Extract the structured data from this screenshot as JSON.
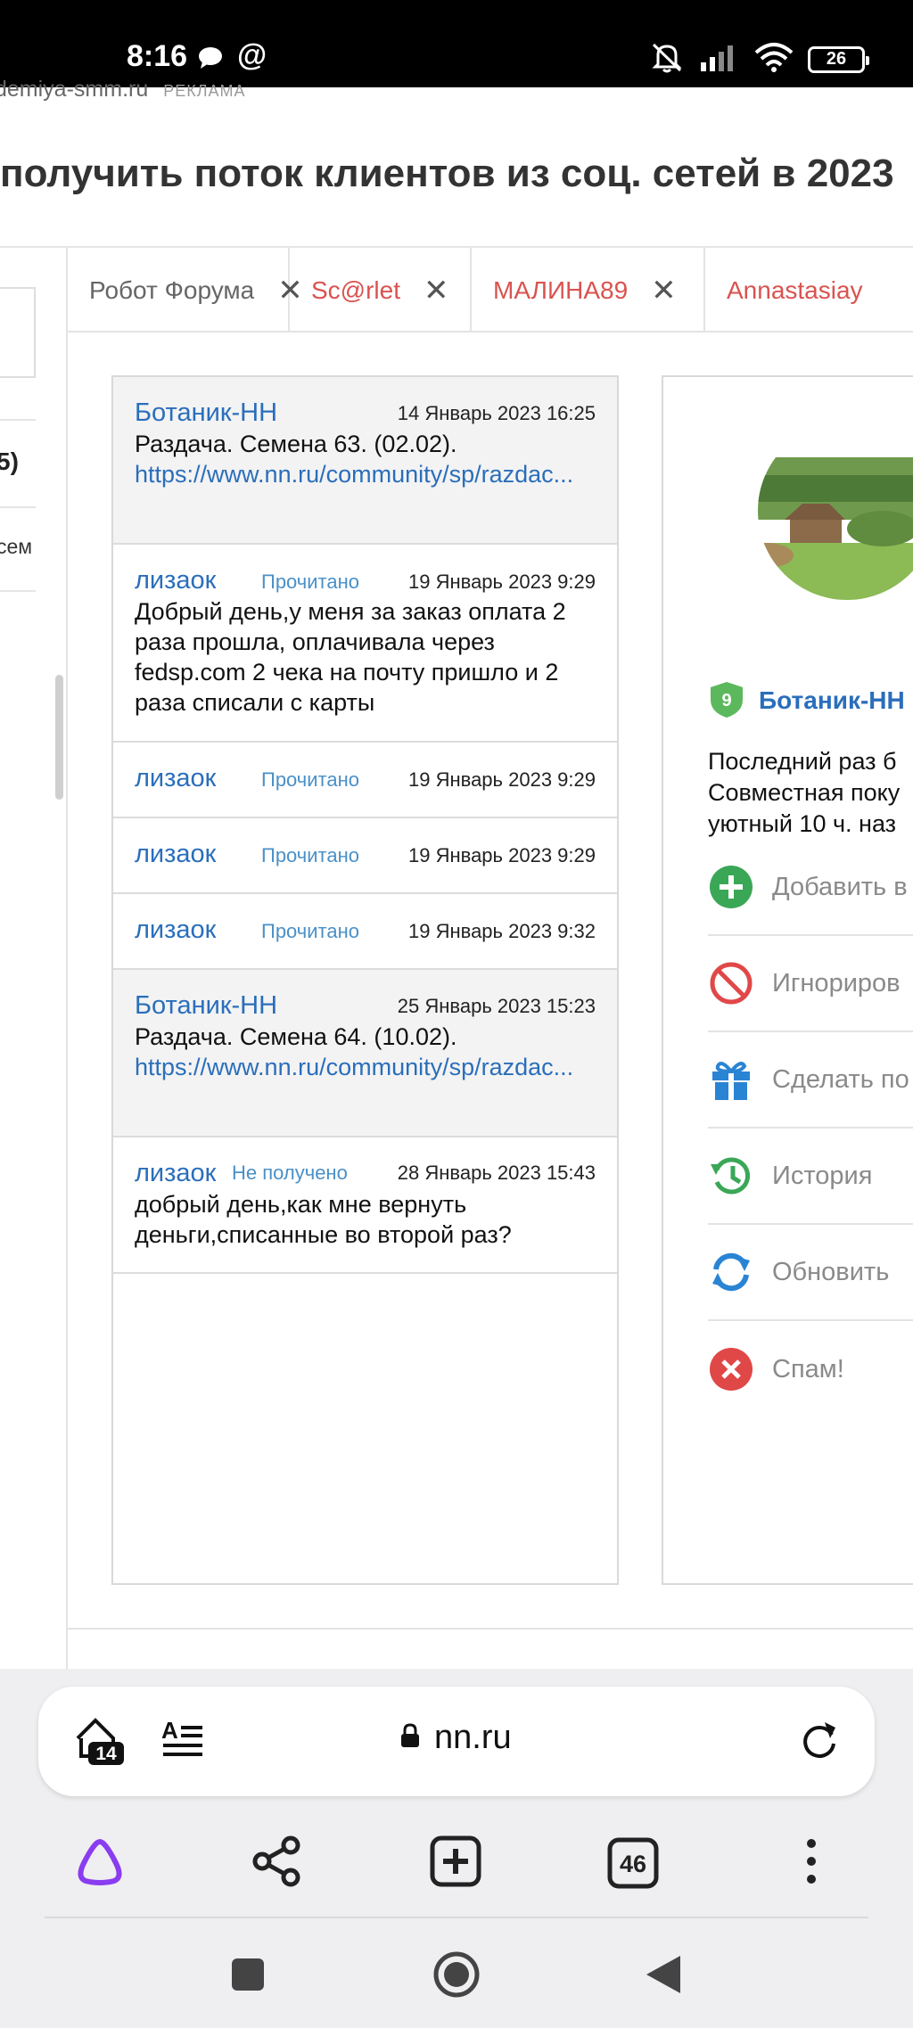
{
  "status_bar": {
    "time": "8:16",
    "at_sign": "@",
    "battery": "26"
  },
  "ad": {
    "domain": "demiya-smm.ru",
    "label": "РЕКЛАМА"
  },
  "headline": "получить поток клиентов из соц. сетей в 2023",
  "left_fragment": {
    "text1": "5)",
    "text2": "сем"
  },
  "tabs": [
    {
      "label": "Робот Форума",
      "color": "#666666"
    },
    {
      "label": "Sc@rlet",
      "color": "#d9534f"
    },
    {
      "label": "МАЛИНА89",
      "color": "#d9534f"
    },
    {
      "label": "Annastasiay",
      "color": "#d9534f"
    }
  ],
  "messages": [
    {
      "author": "Ботаник-НН",
      "status": "",
      "date": "14 Январь 2023 16:25",
      "text": "Раздача. Семена 63. (02.02).",
      "link": "https://www.nn.ru/community/sp/razdac...",
      "gray": true
    },
    {
      "author": "лизаок",
      "status": "Прочитано",
      "date": "19 Январь 2023 9:29",
      "text": "Добрый день,у меня за заказ оплата 2 раза прошла, оплачивала через fedsp.com 2 чека на почту пришло и 2 раза списали с карты",
      "link": "",
      "gray": false
    },
    {
      "author": "лизаок",
      "status": "Прочитано",
      "date": "19 Январь 2023 9:29",
      "text": "",
      "link": "",
      "gray": false
    },
    {
      "author": "лизаок",
      "status": "Прочитано",
      "date": "19 Январь 2023 9:29",
      "text": "",
      "link": "",
      "gray": false
    },
    {
      "author": "лизаок",
      "status": "Прочитано",
      "date": "19 Январь 2023 9:32",
      "text": "",
      "link": "",
      "gray": false
    },
    {
      "author": "Ботаник-НН",
      "status": "",
      "date": "25 Январь 2023 15:23",
      "text": "Раздача. Семена 64. (10.02).",
      "link": "https://www.nn.ru/community/sp/razdac...",
      "gray": true
    },
    {
      "author": "лизаок",
      "status": "Не получено",
      "date": "28 Январь 2023 15:43",
      "text": "добрый день,как мне вернуть деньги,списанные во второй раз?",
      "link": "",
      "gray": false
    }
  ],
  "profile": {
    "level": "9",
    "name": "Ботаник-НН",
    "last_seen_lines": [
      "Последний раз б",
      "Совместная поку",
      "уютный 10 ч. наз"
    ],
    "actions": [
      {
        "label": "Добавить в",
        "icon": "plus-circle-icon",
        "color": "#3aa757"
      },
      {
        "label": "Игнориров",
        "icon": "ban-icon",
        "color": "#e04848"
      },
      {
        "label": "Сделать по",
        "icon": "gift-icon",
        "color": "#2a84d4"
      },
      {
        "label": "История",
        "icon": "history-icon",
        "color": "#3aa757"
      },
      {
        "label": "Обновить",
        "icon": "refresh-icon",
        "color": "#2a84d4"
      },
      {
        "label": "Спам!",
        "icon": "close-circle-icon",
        "color": "#e04848"
      }
    ]
  },
  "browser": {
    "tabs_count": "14",
    "url": "nn.ru",
    "open_tabs": "46"
  }
}
